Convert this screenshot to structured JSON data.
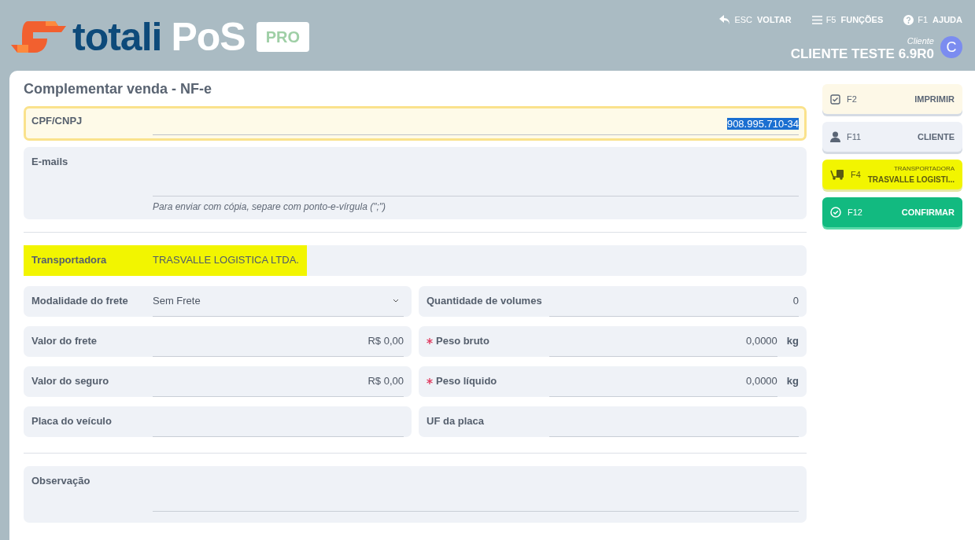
{
  "header": {
    "logo": {
      "brand": "totali",
      "product": "PoS",
      "edition": "PRO"
    },
    "shortcuts": [
      {
        "kind": "back",
        "key": "ESC",
        "label": "VOLTAR"
      },
      {
        "kind": "menu",
        "key": "F5",
        "label": "FUNÇÕES"
      },
      {
        "kind": "help",
        "key": "F1",
        "label": "AJUDA"
      }
    ],
    "customer": {
      "caption": "Cliente",
      "name": "CLIENTE TESTE 6.9R0",
      "initial": "C"
    }
  },
  "form": {
    "title": "Complementar venda - NF-e",
    "cpf": {
      "label": "CPF/CNPJ",
      "value": "908.995.710-34",
      "focused": true,
      "value_selected": true
    },
    "emails": {
      "label": "E-mails",
      "hint": "Para enviar com cópia, separe com ponto-e-vírgula (\";\")"
    },
    "carrier": {
      "label": "Transportadora",
      "value": "TRASVALLE LOGISTICA LTDA.",
      "highlighted": true
    },
    "fields": [
      {
        "kind": "select",
        "label": "Modalidade do frete",
        "value": "Sem Frete",
        "required": false
      },
      {
        "kind": "text",
        "label": "Quantidade de volumes",
        "value": "0",
        "required": false
      },
      {
        "kind": "text",
        "label": "Valor do frete",
        "value": "R$ 0,00",
        "required": false
      },
      {
        "kind": "text",
        "label": "Peso bruto",
        "value": "0,0000",
        "unit": "kg",
        "required": true
      },
      {
        "kind": "text",
        "label": "Valor do seguro",
        "value": "R$ 0,00",
        "required": false
      },
      {
        "kind": "text",
        "label": "Peso líquido",
        "value": "0,0000",
        "unit": "kg",
        "required": true
      },
      {
        "kind": "text",
        "label": "Placa do veículo",
        "required": false
      },
      {
        "kind": "text",
        "label": "UF da placa",
        "required": false
      }
    ],
    "notes": {
      "label": "Observação"
    }
  },
  "actions": [
    {
      "kind": "print",
      "color": "#fdf8e7",
      "key": "F2",
      "label": "IMPRIMIR"
    },
    {
      "kind": "customer",
      "color": "#eef1f7",
      "key": "F11",
      "label": "CLIENTE"
    },
    {
      "kind": "carrier",
      "color": "#f2f500",
      "key": "F4",
      "caption": "TRANSPORTADORA",
      "label": "TRASVALLE LOGISTI..."
    },
    {
      "kind": "confirm",
      "color": "#12ba80",
      "key": "F12",
      "label": "CONFIRMAR"
    }
  ]
}
